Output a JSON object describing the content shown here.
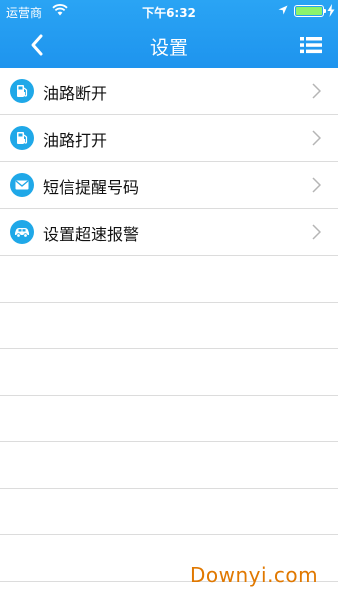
{
  "status_bar": {
    "carrier": "运营商",
    "time": "下午6:32",
    "icons": [
      "wifi-icon",
      "location-arrow-icon",
      "battery-icon",
      "charging-bolt-icon"
    ],
    "battery_level": 1.0
  },
  "navbar": {
    "title": "设置",
    "back_icon": "chevron-left-icon",
    "menu_icon": "list-menu-icon"
  },
  "menu": {
    "items": [
      {
        "label": "油路断开",
        "icon": "fuel-pump-icon"
      },
      {
        "label": "油路打开",
        "icon": "fuel-pump-icon"
      },
      {
        "label": "短信提醒号码",
        "icon": "envelope-icon"
      },
      {
        "label": "设置超速报警",
        "icon": "car-icon"
      }
    ]
  },
  "watermark": "Downyi.com",
  "colors": {
    "header": "#1e94ee",
    "icon_bg": "#1fa8e8",
    "divider": "#dcdcdc",
    "watermark": "#e07800"
  }
}
